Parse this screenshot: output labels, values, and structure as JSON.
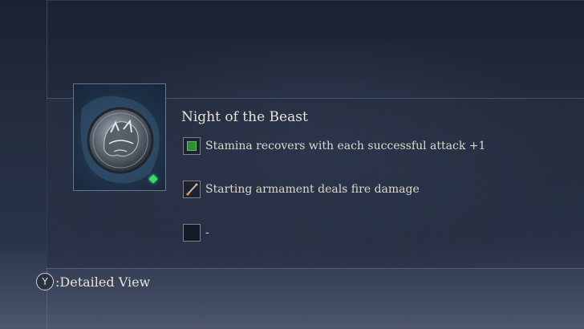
{
  "item": {
    "title": "Night of the Beast",
    "icon": "beast-medallion-icon",
    "selected_marker_color": "#3ddc6a"
  },
  "effects": [
    {
      "icon": "stamina-icon",
      "text": "Stamina recovers with each successful attack +1"
    },
    {
      "icon": "sword-fire-icon",
      "text": "Starting armament deals fire damage"
    },
    {
      "icon": "empty-slot-icon",
      "text": "-"
    }
  ],
  "hint": {
    "button": "Y",
    "label": ":Detailed View"
  }
}
